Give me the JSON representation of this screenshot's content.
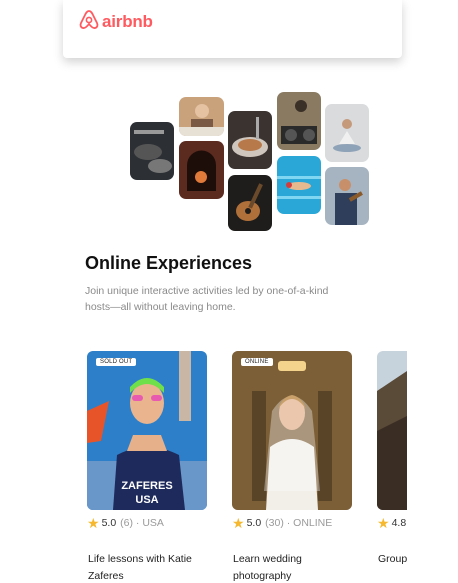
{
  "header": {
    "logo_text": "airbnb"
  },
  "intro": {
    "title": "Online Experiences",
    "subtitle": "Join unique interactive activities led by one-of-a-kind hosts—all without leaving home."
  },
  "collage": {
    "tiles": [
      {
        "name": "collage-tile-cooking-pots"
      },
      {
        "name": "collage-tile-baking"
      },
      {
        "name": "collage-tile-pizza-oven"
      },
      {
        "name": "collage-tile-food-bowl"
      },
      {
        "name": "collage-tile-guitar"
      },
      {
        "name": "collage-tile-dj"
      },
      {
        "name": "collage-tile-swimmer"
      },
      {
        "name": "collage-tile-meditation"
      },
      {
        "name": "collage-tile-musician"
      }
    ]
  },
  "experiences": [
    {
      "badge": "SOLD OUT",
      "rating": "5.0",
      "meta": "(6) · USA",
      "title": "Life lessons with Katie Zaferes"
    },
    {
      "badge": "ONLINE",
      "rating": "5.0",
      "meta": "(30) · ONLINE",
      "title": "Learn wedding photography"
    },
    {
      "badge": "",
      "rating": "4.8",
      "meta": "",
      "title": "Group"
    }
  ],
  "colors": {
    "brand": "#ff5a5f",
    "star": "#f5b82e"
  }
}
